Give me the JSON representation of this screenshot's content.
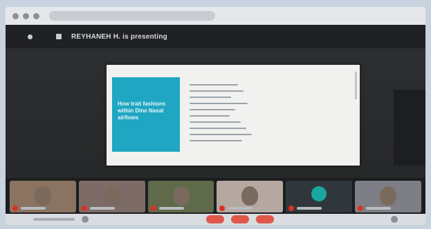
{
  "meeting": {
    "presenting_text": "is presenting",
    "presenter_name": "REYHANEH H."
  },
  "slide": {
    "panel_title": "How trait fashions within Dine Nasal airflows"
  },
  "participants": [
    {
      "kind": "video",
      "bg": "#8a7360"
    },
    {
      "kind": "video",
      "bg": "#7c6b66"
    },
    {
      "kind": "video",
      "bg": "#5f6a4a"
    },
    {
      "kind": "video",
      "bg": "#b4a8a0"
    },
    {
      "kind": "avatar",
      "bg": "#30373c"
    },
    {
      "kind": "video",
      "bg": "#7e7f86"
    }
  ],
  "colors": {
    "slide_accent": "#1fa6c2",
    "mic_muted": "#d93025",
    "end_call": "#e0584a"
  },
  "icons": {
    "rec": "record-icon",
    "pin": "pin-icon",
    "mic": "mic-off-icon",
    "end": "end-call-icon"
  }
}
